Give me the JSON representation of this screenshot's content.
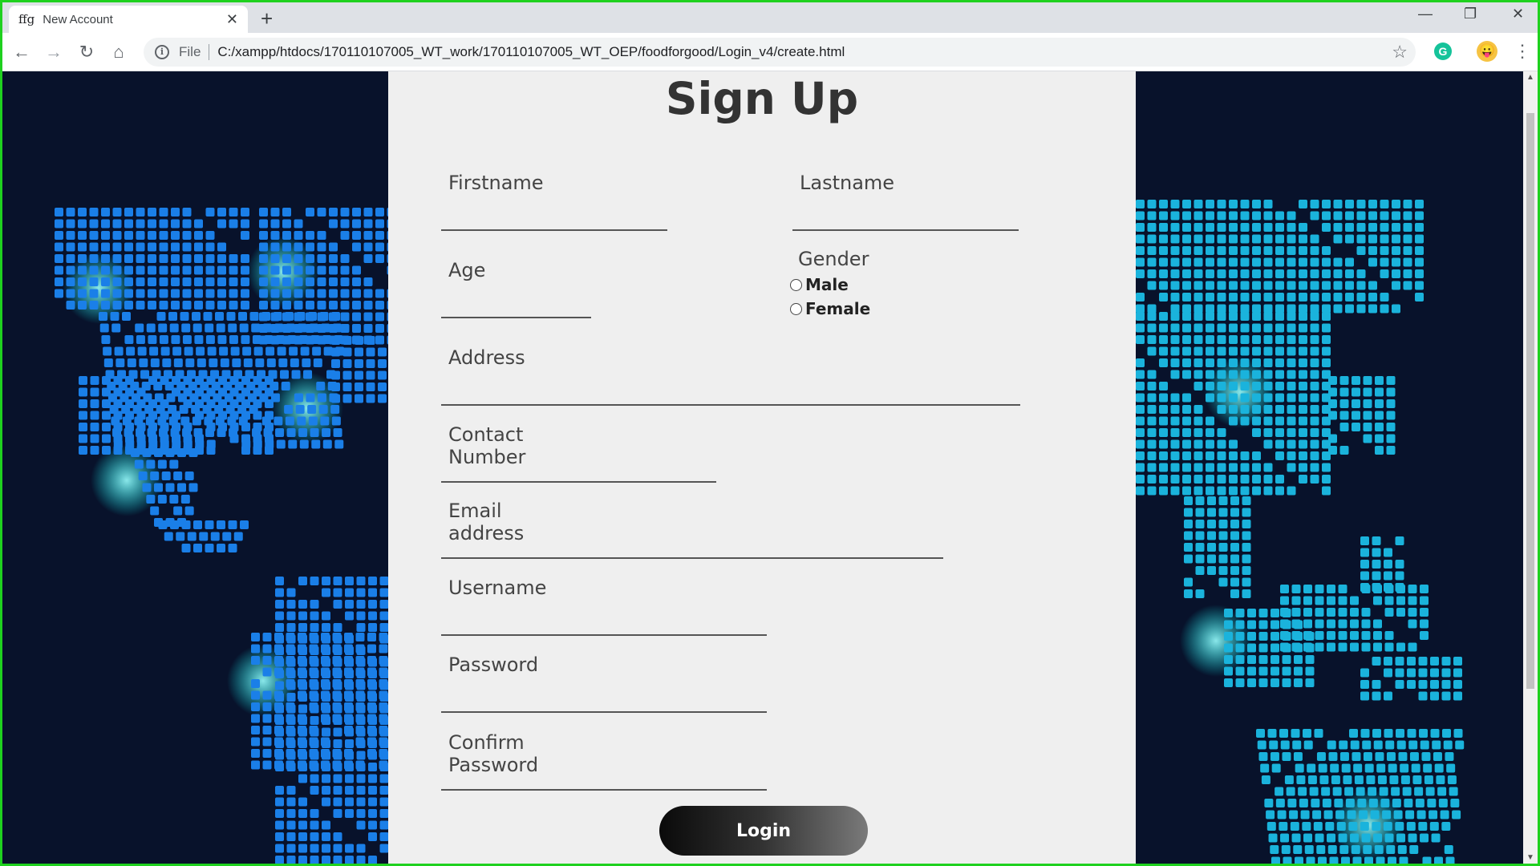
{
  "browser": {
    "tab_favicon": "ffg",
    "tab_title": "New Account",
    "tab_close": "✕",
    "new_tab": "+",
    "minimize": "—",
    "restore": "❐",
    "close": "✕",
    "back": "←",
    "forward": "→",
    "reload": "↻",
    "home": "⌂",
    "info": "i",
    "file_label": "File",
    "url": "C:/xampp/htdocs/170110107005_WT_work/170110107005_WT_OEP/foodforgood/Login_v4/create.html",
    "star": "☆",
    "extension": "G",
    "avatar": "😛",
    "menu": "⋮"
  },
  "form": {
    "title": "Sign Up",
    "firstname": "Firstname",
    "lastname": "Lastname",
    "age": "Age",
    "gender": "Gender",
    "gender_options": [
      "Male",
      "Female"
    ],
    "address": "Address",
    "contact": "Contact Number",
    "email": "Email address",
    "username": "Username",
    "password": "Password",
    "confirm_password": "Confirm Password",
    "submit": "Login"
  },
  "colors": {
    "accent_frame": "#1fd11f",
    "map_background": "#08122b",
    "map_dot_left": "#1a7fe8",
    "map_dot_right": "#1ab3dc",
    "panel": "#efefef"
  }
}
